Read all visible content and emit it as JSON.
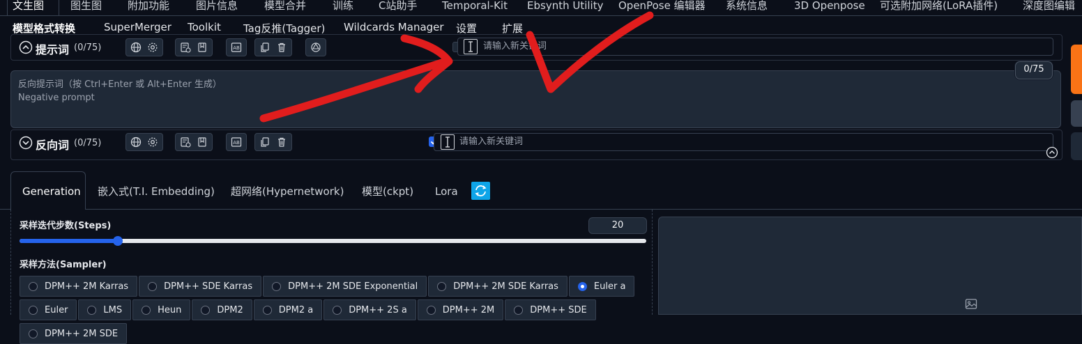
{
  "top_tabs": [
    "文生图",
    "图生图",
    "附加功能",
    "图片信息",
    "模型合并",
    "训练",
    "C站助手",
    "Temporal-Kit",
    "Ebsynth Utility",
    "OpenPose 编辑器",
    "系统信息",
    "3D Openpose",
    "可选附加网络(LoRA插件)",
    "深度图编辑"
  ],
  "second_tabs": [
    "模型格式转换",
    "SuperMerger",
    "Toolkit",
    "Tag反推(Tagger)",
    "Wildcards Manager",
    "设置",
    "扩展"
  ],
  "prompt": {
    "title": "提示词",
    "count": "(0/75)",
    "keyword_placeholder": "请输入新关键词",
    "checked": false
  },
  "negative": {
    "counter": "0/75",
    "placeholder_line1": "反向提示词（按 Ctrl+Enter 或 Alt+Enter 生成）",
    "placeholder_line2": "Negative prompt",
    "title": "反向词",
    "count": "(0/75)",
    "keyword_placeholder": "请输入新关键词",
    "checked": true
  },
  "gen_tabs": [
    "Generation",
    "嵌入式(T.I. Embedding)",
    "超网络(Hypernetwork)",
    "模型(ckpt)",
    "Lora"
  ],
  "steps": {
    "label": "采样迭代步数(Steps)",
    "value": "20",
    "fraction": 0.157
  },
  "sampler": {
    "label": "采样方法(Sampler)",
    "row1": [
      "DPM++ 2M Karras",
      "DPM++ SDE Karras",
      "DPM++ 2M SDE Exponential",
      "DPM++ 2M SDE Karras",
      "Euler a",
      "Euler"
    ],
    "row2": [
      "LMS",
      "Heun",
      "DPM2",
      "DPM2 a",
      "DPM++ 2S a",
      "DPM++ 2M",
      "DPM++ SDE",
      "DPM++ 2M SDE"
    ],
    "selected": "Euler a"
  },
  "colors": {
    "accent": "#2563eb",
    "orange": "#f97316",
    "annotation_red": "#e11d1d"
  }
}
